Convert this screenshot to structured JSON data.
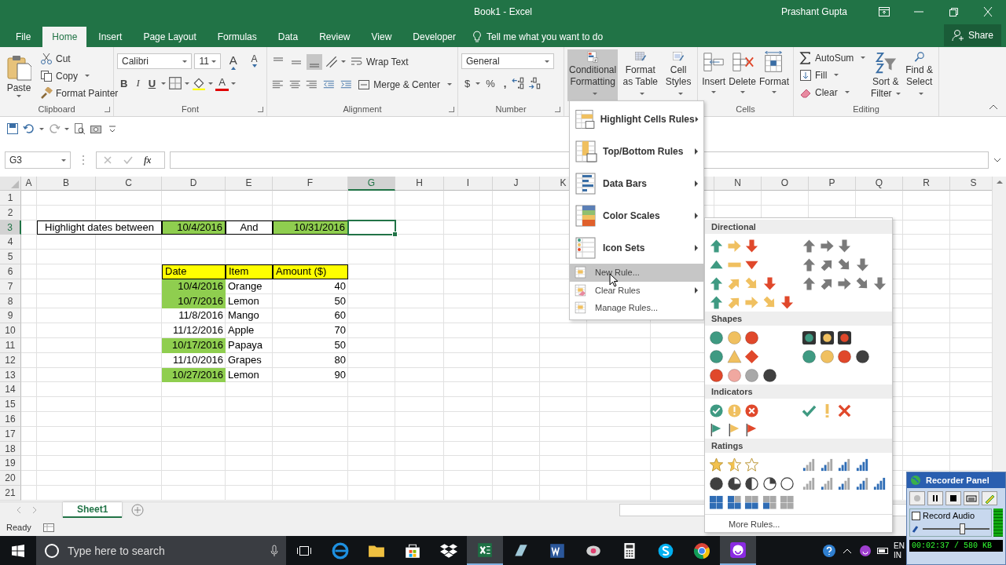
{
  "window": {
    "title": "Book1 - Excel",
    "user": "Prashant Gupta"
  },
  "tabs": [
    {
      "label": "File",
      "selected": false
    },
    {
      "label": "Home",
      "selected": true
    },
    {
      "label": "Insert",
      "selected": false
    },
    {
      "label": "Page Layout",
      "selected": false
    },
    {
      "label": "Formulas",
      "selected": false
    },
    {
      "label": "Data",
      "selected": false
    },
    {
      "label": "Review",
      "selected": false
    },
    {
      "label": "View",
      "selected": false
    },
    {
      "label": "Developer",
      "selected": false
    }
  ],
  "tell_me": "Tell me what you want to do",
  "share": "Share",
  "ribbon": {
    "clipboard": {
      "title": "Clipboard",
      "paste": "Paste",
      "cut": "Cut",
      "copy": "Copy",
      "format_painter": "Format Painter"
    },
    "font": {
      "title": "Font",
      "family": "Calibri",
      "size": "11",
      "grow": "A",
      "shrink": "A",
      "bold": "B",
      "italic": "I",
      "underline": "U",
      "font_color": "A"
    },
    "alignment": {
      "title": "Alignment",
      "wrap_text": "Wrap Text",
      "merge": "Merge & Center",
      "vertical_align": [
        {
          "selected": false
        },
        {
          "selected": false
        },
        {
          "selected": true
        }
      ]
    },
    "number": {
      "title": "Number",
      "format": "General",
      "currency": "$",
      "percent": "%",
      "comma": ","
    },
    "styles": {
      "conditional_formatting": "Conditional Formatting",
      "conditional_open": true,
      "format_as_table": "Format as Table",
      "cell_styles": "Cell Styles"
    },
    "cells": {
      "title": "Cells",
      "insert": "Insert",
      "delete": "Delete",
      "format": "Format"
    },
    "editing": {
      "title": "Editing",
      "autosum": "AutoSum",
      "fill": "Fill",
      "clear": "Clear",
      "sort_filter": "Sort & Filter",
      "find_select": "Find & Select"
    }
  },
  "formula_bar": {
    "name_box": "G3",
    "function_label": "fx"
  },
  "sheet": {
    "columns": [
      {
        "label": "A",
        "selected": false
      },
      {
        "label": "B",
        "selected": false
      },
      {
        "label": "C",
        "selected": false
      },
      {
        "label": "D",
        "selected": false
      },
      {
        "label": "E",
        "selected": false
      },
      {
        "label": "F",
        "selected": false
      },
      {
        "label": "G",
        "selected": true
      },
      {
        "label": "H",
        "selected": false
      },
      {
        "label": "I",
        "selected": false
      },
      {
        "label": "J",
        "selected": false
      },
      {
        "label": "K",
        "selected": false
      },
      {
        "label": "N",
        "selected": false
      },
      {
        "label": "O",
        "selected": false
      },
      {
        "label": "P",
        "selected": false
      },
      {
        "label": "Q",
        "selected": false
      },
      {
        "label": "R",
        "selected": false
      },
      {
        "label": "S",
        "selected": false
      }
    ],
    "rows": [
      {
        "label": "1",
        "selected": false
      },
      {
        "label": "2",
        "selected": false
      },
      {
        "label": "3",
        "selected": true
      },
      {
        "label": "4",
        "selected": false
      },
      {
        "label": "5",
        "selected": false
      },
      {
        "label": "6",
        "selected": false
      },
      {
        "label": "7",
        "selected": false
      },
      {
        "label": "8",
        "selected": false
      },
      {
        "label": "9",
        "selected": false
      },
      {
        "label": "10",
        "selected": false
      },
      {
        "label": "11",
        "selected": false
      },
      {
        "label": "12",
        "selected": false
      },
      {
        "label": "13",
        "selected": false
      },
      {
        "label": "14",
        "selected": false
      },
      {
        "label": "15",
        "selected": false
      },
      {
        "label": "16",
        "selected": false
      },
      {
        "label": "17",
        "selected": false
      },
      {
        "label": "18",
        "selected": false
      },
      {
        "label": "19",
        "selected": false
      },
      {
        "label": "20",
        "selected": false
      },
      {
        "label": "21",
        "selected": false
      }
    ],
    "criteria": {
      "label": "Highlight dates between",
      "start": {
        "value": "10/4/2016",
        "highlighted": true
      },
      "joiner": "And",
      "end": {
        "value": "10/31/2016",
        "highlighted": true
      }
    },
    "table": {
      "columns": [
        "Date",
        "Item",
        "Amount ($)"
      ],
      "rows": [
        {
          "date": "10/4/2016",
          "item": "Orange",
          "amount": "40",
          "highlighted": true
        },
        {
          "date": "10/7/2016",
          "item": "Lemon",
          "amount": "50",
          "highlighted": true
        },
        {
          "date": "11/8/2016",
          "item": "Mango",
          "amount": "60",
          "highlighted": false
        },
        {
          "date": "11/12/2016",
          "item": "Apple",
          "amount": "70",
          "highlighted": false
        },
        {
          "date": "10/17/2016",
          "item": "Papaya",
          "amount": "50",
          "highlighted": true
        },
        {
          "date": "11/10/2016",
          "item": "Grapes",
          "amount": "80",
          "highlighted": false
        },
        {
          "date": "10/27/2016",
          "item": "Lemon",
          "amount": "90",
          "highlighted": true
        }
      ]
    }
  },
  "sheet_tabs": [
    {
      "label": "Sheet1",
      "selected": true
    }
  ],
  "status_bar": {
    "text": "Ready"
  },
  "conditional_menu": {
    "items": [
      {
        "kind": "large",
        "label": "Highlight Cells Rules",
        "submenu": true,
        "hovered": false
      },
      {
        "kind": "large",
        "label": "Top/Bottom Rules",
        "submenu": true,
        "hovered": false
      },
      {
        "kind": "large",
        "label": "Data Bars",
        "submenu": true,
        "hovered": false
      },
      {
        "kind": "large",
        "label": "Color Scales",
        "submenu": true,
        "hovered": false
      },
      {
        "kind": "large",
        "label": "Icon Sets",
        "submenu": true,
        "hovered": false
      },
      {
        "kind": "small",
        "label": "New Rule...",
        "submenu": false,
        "hovered": true
      },
      {
        "kind": "small",
        "label": "Clear Rules",
        "submenu": true,
        "hovered": false
      },
      {
        "kind": "small",
        "label": "Manage Rules...",
        "submenu": false,
        "hovered": false
      }
    ]
  },
  "icon_sets_menu": {
    "sections": [
      {
        "title": "Directional",
        "kind": "directional"
      },
      {
        "title": "Shapes",
        "kind": "shapes"
      },
      {
        "title": "Indicators",
        "kind": "indicators"
      },
      {
        "title": "Ratings",
        "kind": "ratings"
      }
    ],
    "more": "More Rules..."
  },
  "taskbar": {
    "search_placeholder": "Type here to search",
    "tray_text": [
      "EN",
      "IN"
    ]
  },
  "recorder": {
    "title": "Recorder Panel",
    "record_audio": {
      "label": "Record Audio",
      "checked": false
    },
    "volume": {
      "level": 0.6
    },
    "status": "00:02:37 / 580 KB"
  }
}
